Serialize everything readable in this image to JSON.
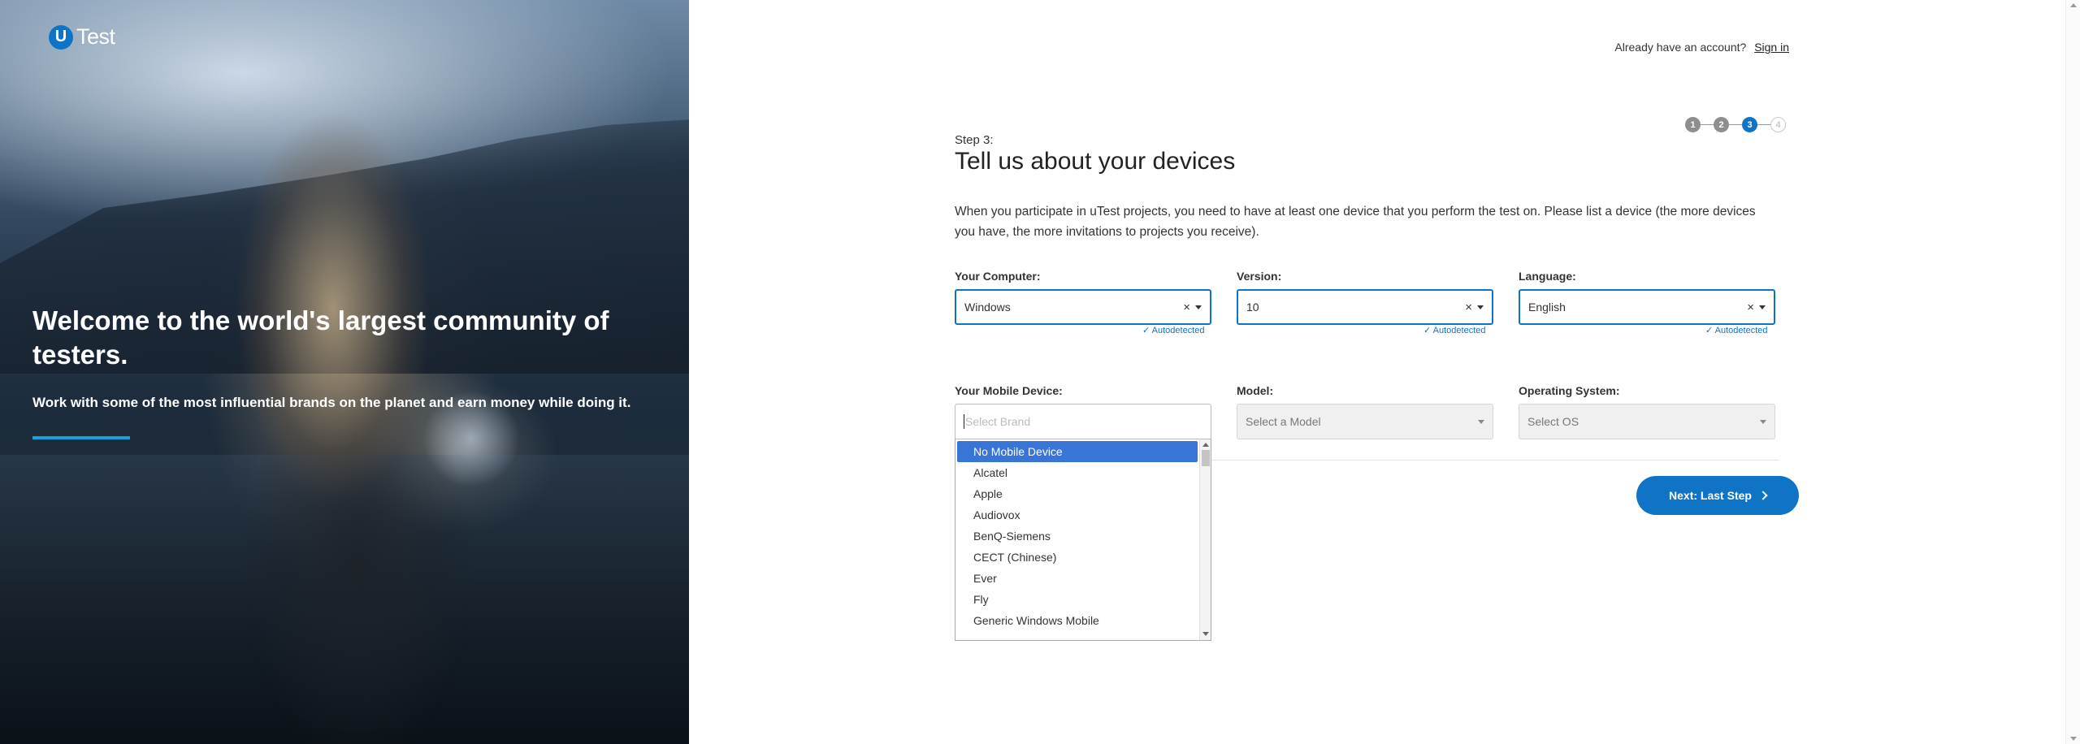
{
  "hero": {
    "logo_mark": "U",
    "logo_word": "Test",
    "title": "Welcome to the world's largest community of testers.",
    "subtitle": "Work with some of the most influential brands on the planet and earn money while doing it."
  },
  "account": {
    "prompt": "Already have an account?",
    "sign_in": "Sign in"
  },
  "steps": [
    "1",
    "2",
    "3",
    "4"
  ],
  "form": {
    "step_label": "Step 3:",
    "title": "Tell us about your devices",
    "intro": "When you participate in uTest projects, you need to have at least one device that you perform the test on. Please list a device (the more devices you have, the more invitations to projects you receive).",
    "computer": {
      "label": "Your Computer:",
      "value": "Windows",
      "autodetected": "Autodetected"
    },
    "version": {
      "label": "Version:",
      "value": "10",
      "autodetected": "Autodetected"
    },
    "language": {
      "label": "Language:",
      "value": "English",
      "autodetected": "Autodetected"
    },
    "mobile": {
      "label": "Your Mobile Device:",
      "placeholder": "Select Brand"
    },
    "model": {
      "label": "Model:",
      "placeholder": "Select a Model"
    },
    "os": {
      "label": "Operating System:",
      "placeholder": "Select OS"
    },
    "brand_options": [
      "No Mobile Device",
      "Alcatel",
      "Apple",
      "Audiovox",
      "BenQ-Siemens",
      "CECT (Chinese)",
      "Ever",
      "Fly",
      "Generic Windows Mobile"
    ],
    "next_button": "Next: Last Step"
  },
  "colors": {
    "accent": "#0f74c5",
    "highlight": "#3875d7",
    "hero_line": "#14a2dc"
  }
}
